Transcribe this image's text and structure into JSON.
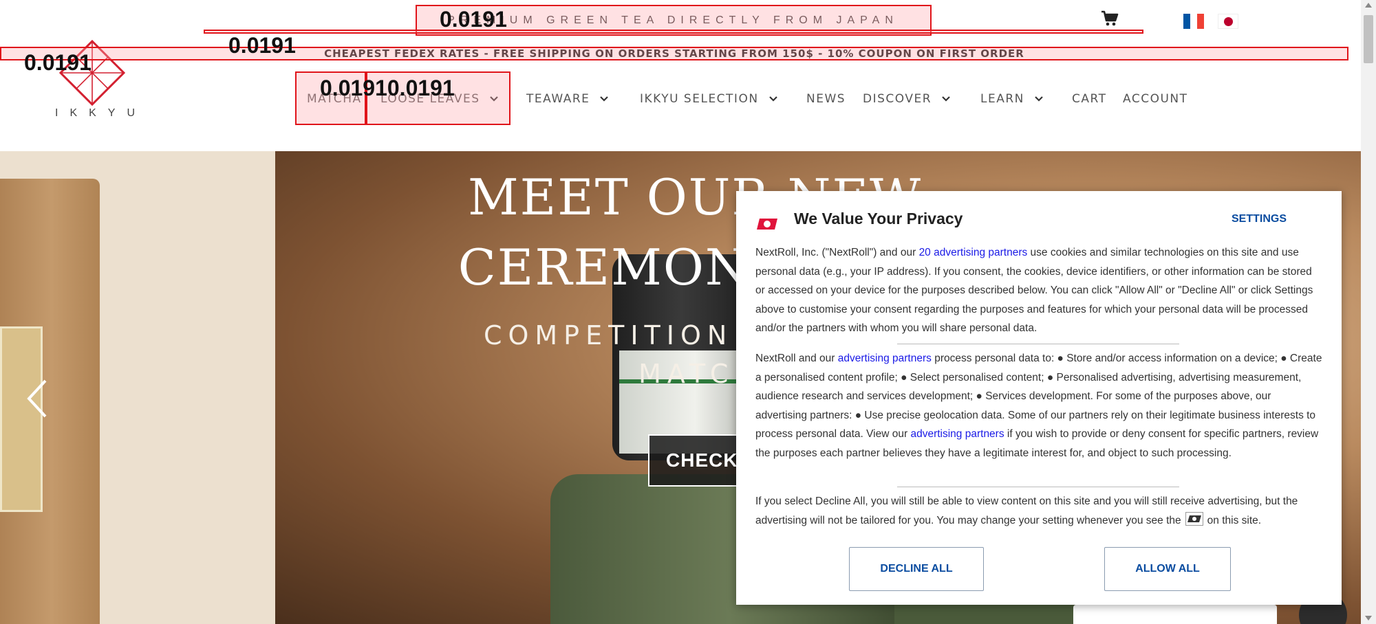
{
  "topbar": {
    "tagline": "PREMIUM GREEN TEA DIRECTLY FROM JAPAN",
    "cart_icon": "cart-icon",
    "flags": [
      "flag-france-icon",
      "flag-japan-icon"
    ]
  },
  "shipping_banner": "CHEAPEST FEDEX RATES - FREE SHIPPING ON ORDERS STARTING FROM 150$ - 10% COUPON ON FIRST ORDER",
  "logo": {
    "text": "IKKYU"
  },
  "nav": {
    "items": [
      {
        "label": "MATCHA",
        "has_dropdown": false
      },
      {
        "label": "LOOSE LEAVES",
        "has_dropdown": true
      },
      {
        "label": "TEAWARE",
        "has_dropdown": true
      },
      {
        "label": "IKKYU SELECTION",
        "has_dropdown": true
      },
      {
        "label": "NEWS",
        "has_dropdown": false
      },
      {
        "label": "DISCOVER",
        "has_dropdown": true
      },
      {
        "label": "LEARN",
        "has_dropdown": true
      },
      {
        "label": "CART",
        "has_dropdown": false
      },
      {
        "label": "ACCOUNT",
        "has_dropdown": false
      }
    ]
  },
  "hero": {
    "title_line1": "MEET OUR NEW",
    "title_line2": "CEREMONIA",
    "subtitle_line1": "COMPETITION AND",
    "subtitle_line2": "MATCHA F",
    "cta_label": "CHECK"
  },
  "annotations": {
    "tagline_score": "0.0191",
    "banner_score": "0.0191",
    "logo_score": "0.0191",
    "nav_score": "0.01910.0191"
  },
  "privacy": {
    "title": "We Value Your Privacy",
    "settings_label": "SETTINGS",
    "p1_before": "NextRoll, Inc. (\"NextRoll\") and our ",
    "p1_link": "20 advertising partners",
    "p1_after": " use cookies and similar technologies on this site and use personal data (e.g., your IP address). If you consent, the cookies, device identifiers, or other information can be stored or accessed on your device for the purposes described below. You can click \"Allow All\" or \"Decline All\" or click Settings above to customise your consent regarding the purposes and features for which your personal data will be processed and/or the partners with whom you will share personal data.",
    "p2_before": "NextRoll and our ",
    "p2_link1": "advertising partners",
    "p2_mid": " process personal data to: ● Store and/or access information on a device; ● Create a personalised content profile; ● Select personalised content; ● Personalised advertising, advertising measurement, audience research and services development; ● Services development. For some of the purposes above, our advertising partners: ● Use precise geolocation data. Some of our partners rely on their legitimate business interests to process personal data. View our ",
    "p2_link2": "advertising partners",
    "p2_after": " if you wish to provide or deny consent for specific partners, review the purposes each partner believes they have a legitimate interest for, and object to such processing.",
    "p3_before": "If you select Decline All, you will still be able to view content on this site and you will still receive advertising, but the advertising will not be tailored for you. You may change your setting whenever you see the",
    "p3_after": "on this site.",
    "decline_label": "DECLINE ALL",
    "allow_label": "ALLOW ALL"
  }
}
